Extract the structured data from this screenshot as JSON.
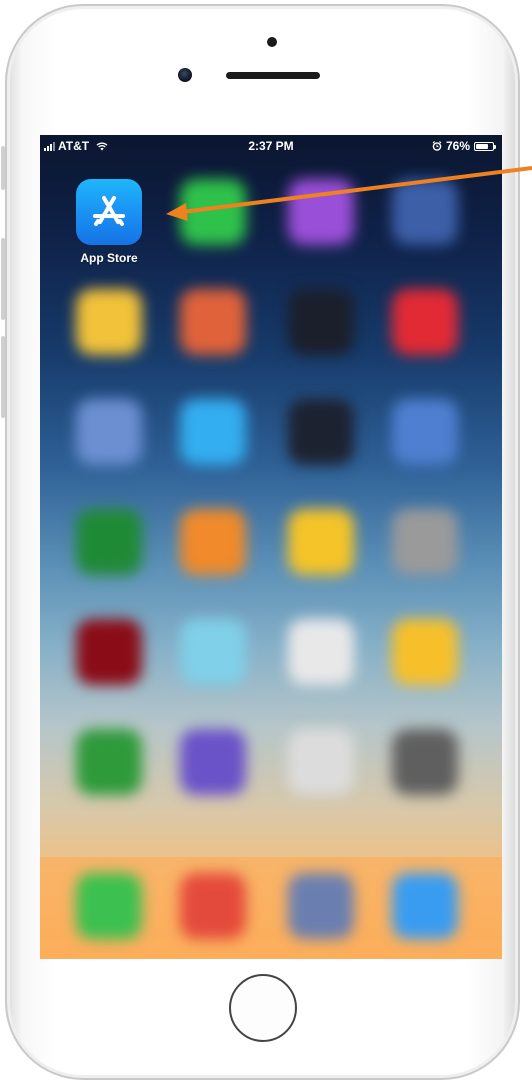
{
  "status_bar": {
    "carrier": "AT&T",
    "time": "2:37 PM",
    "battery": "76%",
    "battery_level": 0.76,
    "icons": [
      "signal-bars-icon",
      "wifi-icon",
      "alarm-clock-icon",
      "battery-icon"
    ]
  },
  "home_screen": {
    "highlighted_app": {
      "label": "App Store",
      "icon": "app-store-icon",
      "color": "#1a8ff3"
    },
    "blurred_app_colors": [
      [
        "#2fc24a",
        "#9a4fd8",
        "#3c5fa8"
      ],
      [
        "#f2c23a",
        "#e0623a",
        "#1b1f2b",
        "#e22a35"
      ],
      [
        "#6c8fd2",
        "#33aef0",
        "#1d2230",
        "#4f7fd0"
      ],
      [
        "#1f8a35",
        "#f08a2a",
        "#f5c428",
        "#9a9a9a"
      ],
      [
        "#8a0c16",
        "#7fd0e8",
        "#e8e8e8",
        "#f7c02a"
      ],
      [
        "#2e9a3a",
        "#6a52c8",
        "#dcdcdc",
        "#5f5f5f"
      ]
    ],
    "dock_colors": [
      "#3cc04f",
      "#e44a3c",
      "#6a7fb0",
      "#3a9cf0"
    ]
  },
  "annotation": {
    "arrow_color": "#f0811f",
    "target": "App Store"
  }
}
